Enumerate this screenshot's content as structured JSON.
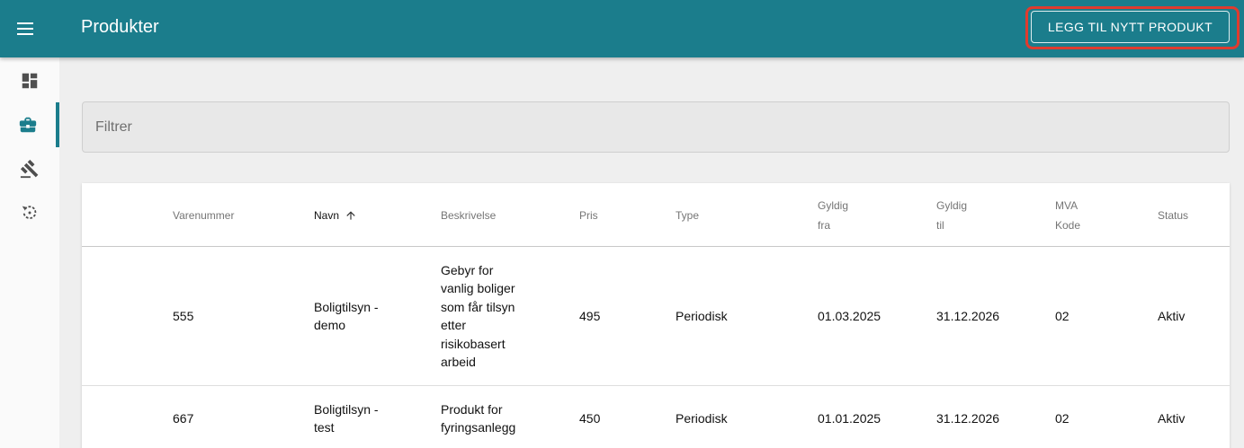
{
  "header": {
    "title": "Produkter",
    "add_button_label": "LEGG TIL NYTT PRODUKT"
  },
  "sidebar": {
    "items": [
      {
        "name": "dashboard",
        "icon": "dashboard-icon",
        "active": false
      },
      {
        "name": "products",
        "icon": "briefcase-icon",
        "active": true
      },
      {
        "name": "hearings",
        "icon": "gavel-icon",
        "active": false
      },
      {
        "name": "history",
        "icon": "history-icon",
        "active": false
      }
    ]
  },
  "filter": {
    "placeholder": "Filtrer",
    "value": ""
  },
  "table": {
    "columns": [
      {
        "line1": "Varenummer",
        "line2": ""
      },
      {
        "line1": "Navn",
        "line2": "",
        "sorted": "asc"
      },
      {
        "line1": "Beskrivelse",
        "line2": ""
      },
      {
        "line1": "Pris",
        "line2": ""
      },
      {
        "line1": "Type",
        "line2": ""
      },
      {
        "line1": "Gyldig",
        "line2": "fra"
      },
      {
        "line1": "Gyldig",
        "line2": "til"
      },
      {
        "line1": "MVA",
        "line2": "Kode"
      },
      {
        "line1": "Status",
        "line2": ""
      }
    ],
    "rows": [
      {
        "varenummer": "555",
        "navn": [
          "Boligtilsyn -",
          "demo"
        ],
        "beskrivelse": [
          "Gebyr for",
          "vanlig boliger",
          "som får tilsyn",
          "etter",
          "risikobasert",
          "arbeid"
        ],
        "pris": "495",
        "type": "Periodisk",
        "gyldig_fra": "01.03.2025",
        "gyldig_til": "31.12.2026",
        "mva_kode": "02",
        "status": "Aktiv"
      },
      {
        "varenummer": "667",
        "navn": [
          "Boligtilsyn -",
          "test"
        ],
        "beskrivelse": [
          "Produkt for",
          "fyringsanlegg"
        ],
        "pris": "450",
        "type": "Periodisk",
        "gyldig_fra": "01.01.2025",
        "gyldig_til": "31.12.2026",
        "mva_kode": "02",
        "status": "Aktiv"
      }
    ]
  },
  "colors": {
    "header_bg": "#1b7d8c",
    "highlight": "#e03b2e",
    "background": "#efefef"
  }
}
